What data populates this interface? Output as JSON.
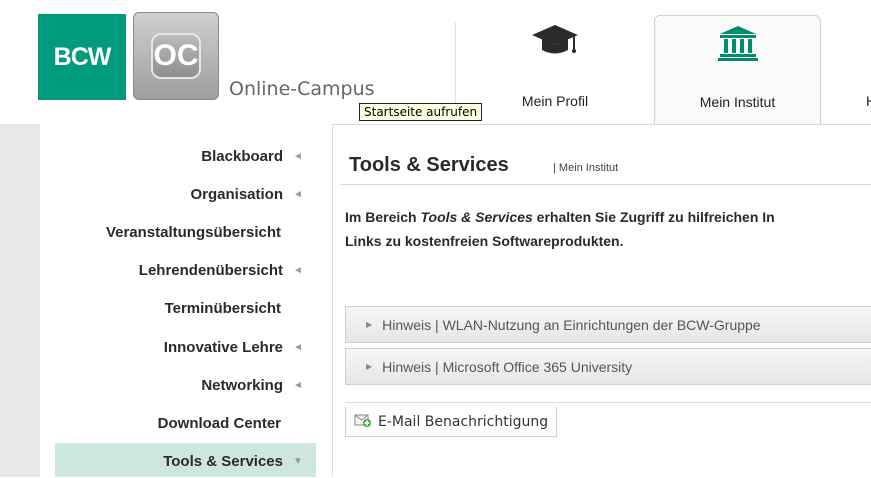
{
  "header": {
    "logo_bcw": "BCW",
    "logo_oc": "OC",
    "brand": "Online-Campus",
    "tooltip": "Startseite aufrufen",
    "tabs": [
      {
        "label": "Mein Profil",
        "icon": "graduation-cap-icon"
      },
      {
        "label": "Mein Institut",
        "icon": "institution-icon",
        "active": true
      },
      {
        "label": "H",
        "icon": ""
      }
    ]
  },
  "sidebar": {
    "items": [
      {
        "label": "Blackboard",
        "arrow": "◄"
      },
      {
        "label": "Organisation",
        "arrow": "◄"
      },
      {
        "label": "Veranstaltungsübersicht",
        "arrow": ""
      },
      {
        "label": "Lehrendenübersicht",
        "arrow": "◄"
      },
      {
        "label": "Terminübersicht",
        "arrow": ""
      },
      {
        "label": "Innovative Lehre",
        "arrow": "◄"
      },
      {
        "label": "Networking",
        "arrow": "◄"
      },
      {
        "label": "Download Center",
        "arrow": ""
      },
      {
        "label": "Tools & Services",
        "arrow": "▼",
        "active": true
      }
    ]
  },
  "content": {
    "title": "Tools & Services",
    "subtitle": "| Mein Institut",
    "intro_prefix": "Im Bereich ",
    "intro_em": "Tools & Services",
    "intro_rest": " erhalten Sie Zugriff zu hilfreichen In",
    "intro_line2": "Links zu kostenfreien Softwareprodukten.",
    "accordions": [
      "Hinweis | WLAN-Nutzung an Einrichtungen der BCW-Gruppe",
      "Hinweis | Microsoft Office 365 University"
    ],
    "email_button": "E-Mail Benachrichtigung"
  },
  "colors": {
    "brand_green": "#009a7c",
    "active_menu_bg": "#cde6e0"
  }
}
